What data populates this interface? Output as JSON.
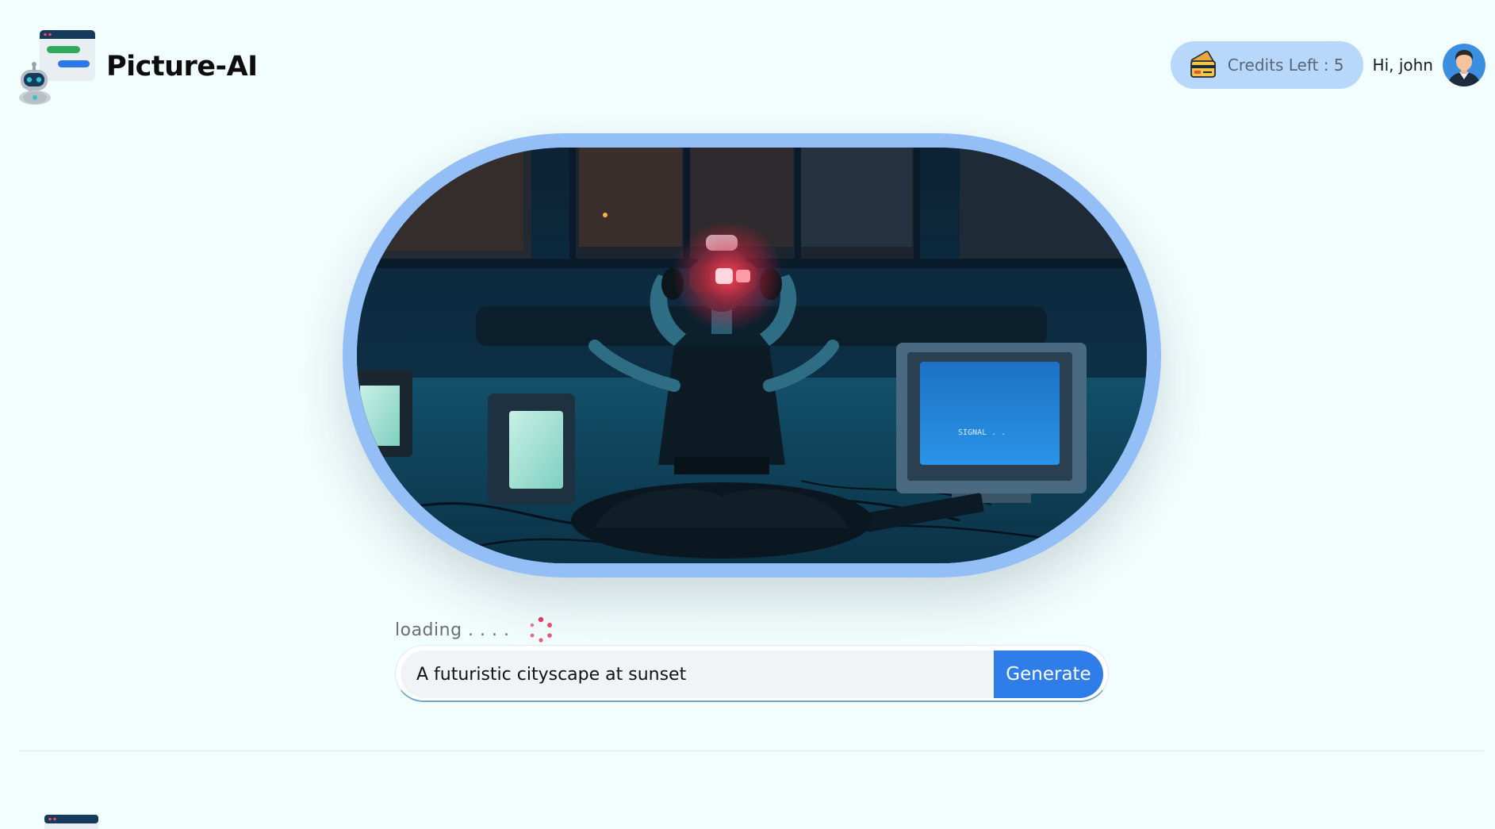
{
  "header": {
    "brand": "Picture-AI",
    "credits_label": "Credits Left : 5",
    "greeting": "Hi, john"
  },
  "prompt": {
    "status": "loading . . . .",
    "value": "A futuristic cityscape at sunset",
    "button_label": "Generate"
  },
  "hero": {
    "monitor_text": "SIGNAL . ."
  },
  "icons": {
    "logo": "robot-chat-logo-icon",
    "credits": "credit-card-icon",
    "avatar": "user-avatar",
    "spinner": "loading-spinner-icon"
  },
  "colors": {
    "background": "#f2fdfd",
    "accent": "#2f7de8",
    "credits_pill": "#b8d8fb",
    "hero_frame": "#93bff6",
    "spinner": "#e5375b"
  }
}
